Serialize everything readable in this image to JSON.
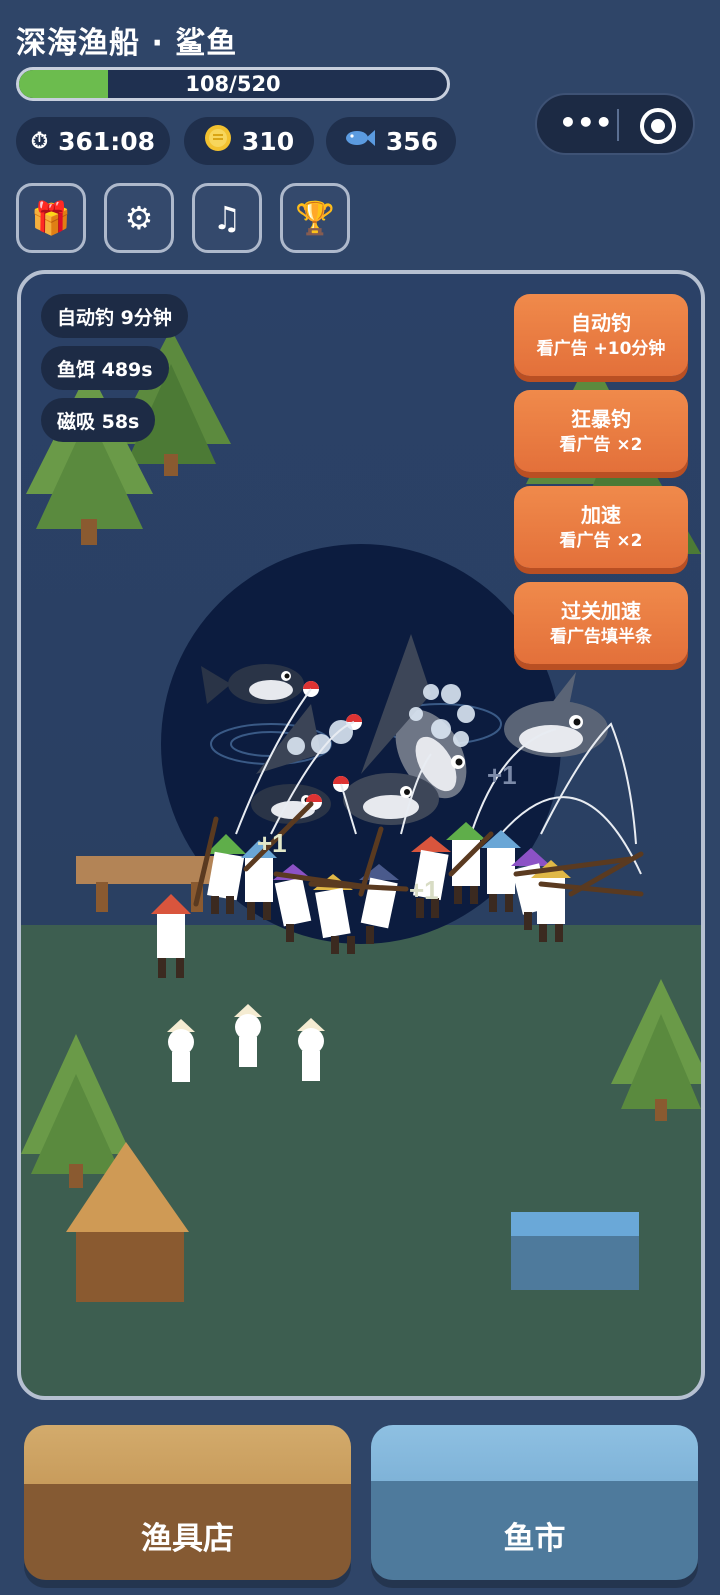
{
  "header": {
    "title": "深海渔船 · 鲨鱼",
    "progress_text": "108/520",
    "progress_fraction": 0.208
  },
  "stats": {
    "timer": {
      "icon": "stopwatch-icon",
      "value": "361:08"
    },
    "coins": {
      "icon": "coin-icon",
      "value": "310"
    },
    "fish": {
      "icon": "fish-icon",
      "value": "356"
    }
  },
  "capsule": {
    "more": "•••"
  },
  "toolbar": {
    "gift": {
      "icon": "gift-icon",
      "glyph": "🎁"
    },
    "settings": {
      "icon": "gear-icon",
      "glyph": "⚙"
    },
    "music": {
      "icon": "music-icon",
      "glyph": "♫"
    },
    "trophy": {
      "icon": "trophy-icon",
      "glyph": "🏆"
    }
  },
  "buffs": [
    {
      "label": "自动钓 9分钟"
    },
    {
      "label": "鱼饵 489s"
    },
    {
      "label": "磁吸 58s"
    }
  ],
  "ad_buttons": [
    {
      "title": "自动钓",
      "sub": "看广告 +10分钟"
    },
    {
      "title": "狂暴钓",
      "sub": "看广告 ×2"
    },
    {
      "title": "加速",
      "sub": "看广告 ×2"
    },
    {
      "title": "过关加速",
      "sub": "看广告填半条"
    }
  ],
  "floating_text": [
    "+1",
    "+1",
    "+1"
  ],
  "bottom": {
    "shop_label": "渔具店",
    "market_label": "鱼市"
  },
  "colors": {
    "background": "#2f4568",
    "progress_fill": "#6cbc4e",
    "ad_button": "#ec7e44",
    "shop_brown": "#855a33",
    "market_blue": "#4e7a9c"
  }
}
